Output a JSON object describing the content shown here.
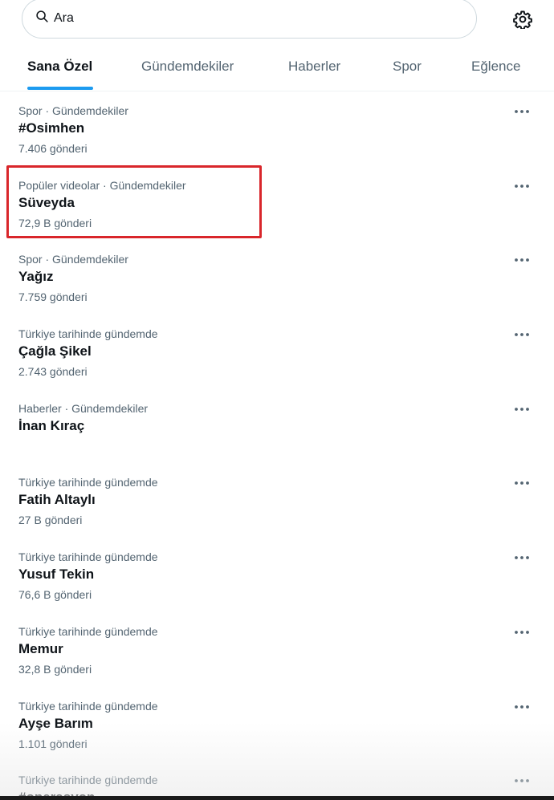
{
  "search": {
    "placeholder": "Ara"
  },
  "icons": {
    "search": "search-icon",
    "settings": "gear-icon",
    "more": "more-horizontal-icon"
  },
  "colors": {
    "accent": "#1d9bf0",
    "highlight": "#d9262b",
    "secondary_text": "#536471"
  },
  "tabs": [
    {
      "label": "Sana Özel",
      "active": true
    },
    {
      "label": "Gündemdekiler",
      "active": false
    },
    {
      "label": "Haberler",
      "active": false
    },
    {
      "label": "Spor",
      "active": false
    },
    {
      "label": "Eğlence",
      "active": false
    }
  ],
  "trends": [
    {
      "meta": "Spor · Gündemdekiler",
      "title": "#Osimhen",
      "count": "7.406 gönderi"
    },
    {
      "meta": "Popüler videolar · Gündemdekiler",
      "title": "Süveyda",
      "count": "72,9 B gönderi",
      "highlighted": true
    },
    {
      "meta": "Spor · Gündemdekiler",
      "title": "Yağız",
      "count": "7.759 gönderi"
    },
    {
      "meta": "Türkiye tarihinde gündemde",
      "title": "Çağla Şikel",
      "count": "2.743 gönderi"
    },
    {
      "meta": "Haberler · Gündemdekiler",
      "title": "İnan Kıraç",
      "count": ""
    },
    {
      "meta": "Türkiye tarihinde gündemde",
      "title": "Fatih Altaylı",
      "count": "27 B gönderi"
    },
    {
      "meta": "Türkiye tarihinde gündemde",
      "title": "Yusuf Tekin",
      "count": "76,6 B gönderi"
    },
    {
      "meta": "Türkiye tarihinde gündemde",
      "title": "Memur",
      "count": "32,8 B gönderi"
    },
    {
      "meta": "Türkiye tarihinde gündemde",
      "title": "Ayşe Barım",
      "count": "1.101 gönderi"
    },
    {
      "meta": "Türkiye tarihinde gündemde",
      "title": "#operasyon",
      "count": ""
    }
  ]
}
